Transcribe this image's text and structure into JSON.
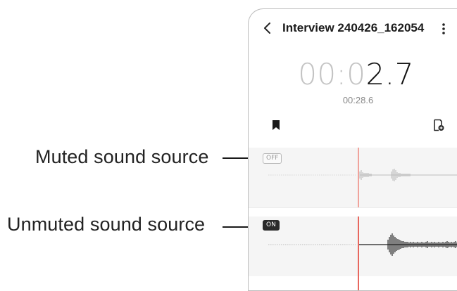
{
  "callouts": {
    "muted": "Muted sound source",
    "unmuted": "Unmuted sound source"
  },
  "header": {
    "title": "Interview 240426_162054",
    "back_icon": "chevron-left-icon",
    "more_icon": "vertical-dots-icon"
  },
  "timer": {
    "elapsed_dim": "00:0",
    "elapsed_lit": "2.7",
    "total": "00:28.6"
  },
  "toolbar": {
    "bookmark_icon": "bookmark-icon",
    "add_bookmark_icon": "add-bookmark-icon"
  },
  "tracks": [
    {
      "toggle_label": "OFF",
      "state": "muted"
    },
    {
      "toggle_label": "ON",
      "state": "unmuted"
    }
  ],
  "colors": {
    "playhead": "#e8675e",
    "track_bg": "#f5f5f5",
    "toggle_on_bg": "#2b2b2b"
  }
}
